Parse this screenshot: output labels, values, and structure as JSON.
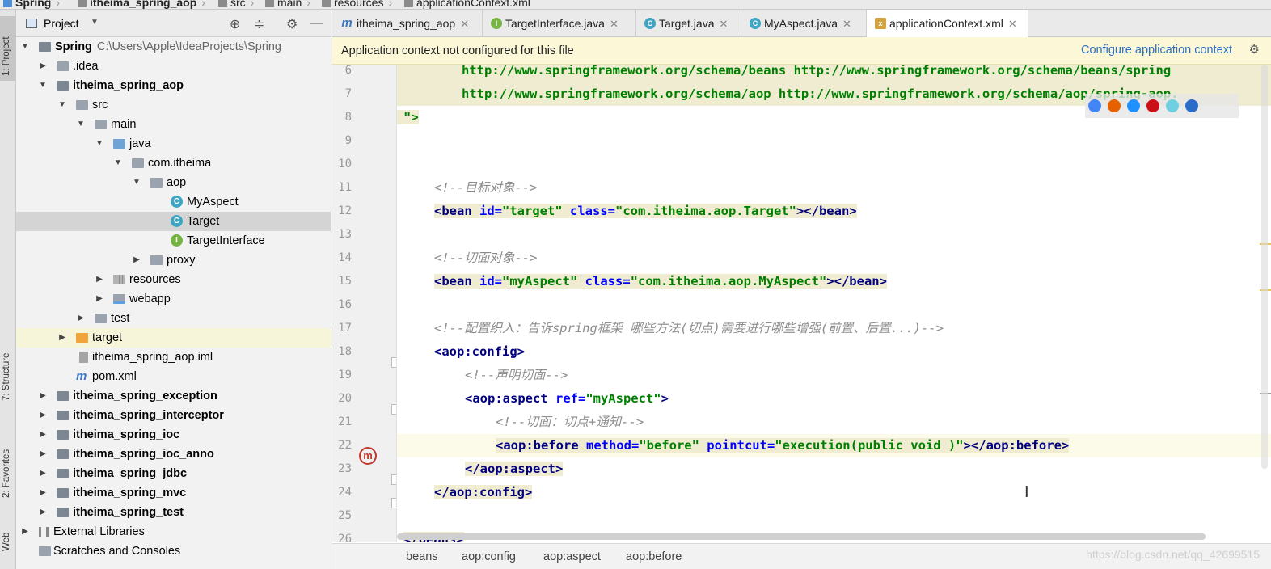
{
  "nav": {
    "crumbs": [
      "Spring",
      "itheima_spring_aop",
      "src",
      "main",
      "resources",
      "applicationContext.xml"
    ]
  },
  "left_strip": {
    "project_tab": "1: Project",
    "structure_tab": "7: Structure",
    "favorites_tab": "2: Favorites",
    "web_tab": "Web"
  },
  "project": {
    "title": "Project",
    "tree": [
      {
        "label": "Spring",
        "path": "C:\\Users\\Apple\\IdeaProjects\\Spring"
      },
      {
        "label": ".idea"
      },
      {
        "label": "itheima_spring_aop"
      },
      {
        "label": "src"
      },
      {
        "label": "main"
      },
      {
        "label": "java"
      },
      {
        "label": "com.itheima"
      },
      {
        "label": "aop"
      },
      {
        "label": "MyAspect"
      },
      {
        "label": "Target"
      },
      {
        "label": "TargetInterface"
      },
      {
        "label": "proxy"
      },
      {
        "label": "resources"
      },
      {
        "label": "webapp"
      },
      {
        "label": "test"
      },
      {
        "label": "target"
      },
      {
        "label": "itheima_spring_aop.iml"
      },
      {
        "label": "pom.xml"
      },
      {
        "label": "itheima_spring_exception"
      },
      {
        "label": "itheima_spring_interceptor"
      },
      {
        "label": "itheima_spring_ioc"
      },
      {
        "label": "itheima_spring_ioc_anno"
      },
      {
        "label": "itheima_spring_jdbc"
      },
      {
        "label": "itheima_spring_mvc"
      },
      {
        "label": "itheima_spring_test"
      },
      {
        "label": "External Libraries"
      },
      {
        "label": "Scratches and Consoles"
      }
    ]
  },
  "tabs": [
    {
      "label": "itheima_spring_aop"
    },
    {
      "label": "TargetInterface.java"
    },
    {
      "label": "Target.java"
    },
    {
      "label": "MyAspect.java"
    },
    {
      "label": "applicationContext.xml"
    }
  ],
  "notice": {
    "message": "Application context not configured for this file",
    "action": "Configure application context"
  },
  "code": {
    "line_numbers": [
      "6",
      "7",
      "8",
      "9",
      "10",
      "11",
      "12",
      "13",
      "14",
      "15",
      "16",
      "17",
      "18",
      "19",
      "20",
      "21",
      "22",
      "23",
      "24",
      "25",
      "26"
    ],
    "l6_text": "http://www.springframework.org/schema/beans http://www.springframework.org/schema/beans/spring",
    "l7_text": "http://www.springframework.org/schema/aop http://www.springframework.org/schema/aop/spring-aop.",
    "l8_text": "\">",
    "l11_comment": "<!--目标对象-->",
    "l12": {
      "open": "<bean ",
      "id_attr": "id=",
      "id_val": "\"target\"",
      "cls_attr": " class=",
      "cls_val": "\"com.itheima.aop.Target\"",
      "close": "></bean>"
    },
    "l14_comment": "<!--切面对象-->",
    "l15": {
      "open": "<bean ",
      "id_attr": "id=",
      "id_val": "\"myAspect\"",
      "cls_attr": " class=",
      "cls_val": "\"com.itheima.aop.MyAspect\"",
      "close": "></bean>"
    },
    "l17_comment": "<!--配置织入：告诉spring框架 哪些方法(切点)需要进行哪些增强(前置、后置...)-->",
    "l18": "<aop:config>",
    "l19_comment": "<!--声明切面-->",
    "l20": {
      "open": "<aop:aspect ",
      "attr": "ref=",
      "val": "\"myAspect\"",
      "close": ">"
    },
    "l21_comment": "<!--切面：切点+通知-->",
    "l22": {
      "open": "<aop:before ",
      "m_attr": "method=",
      "m_val": "\"before\"",
      "p_attr": " pointcut=",
      "p_val": "\"execution(public void )\"",
      "close": "></aop:before>"
    },
    "l23": "</aop:aspect>",
    "l24": "</aop:config>",
    "l26": "</beans>"
  },
  "breadcrumb": [
    "beans",
    "aop:config",
    "aop:aspect",
    "aop:before"
  ],
  "watermark": "https://blog.csdn.net/qq_42699515"
}
